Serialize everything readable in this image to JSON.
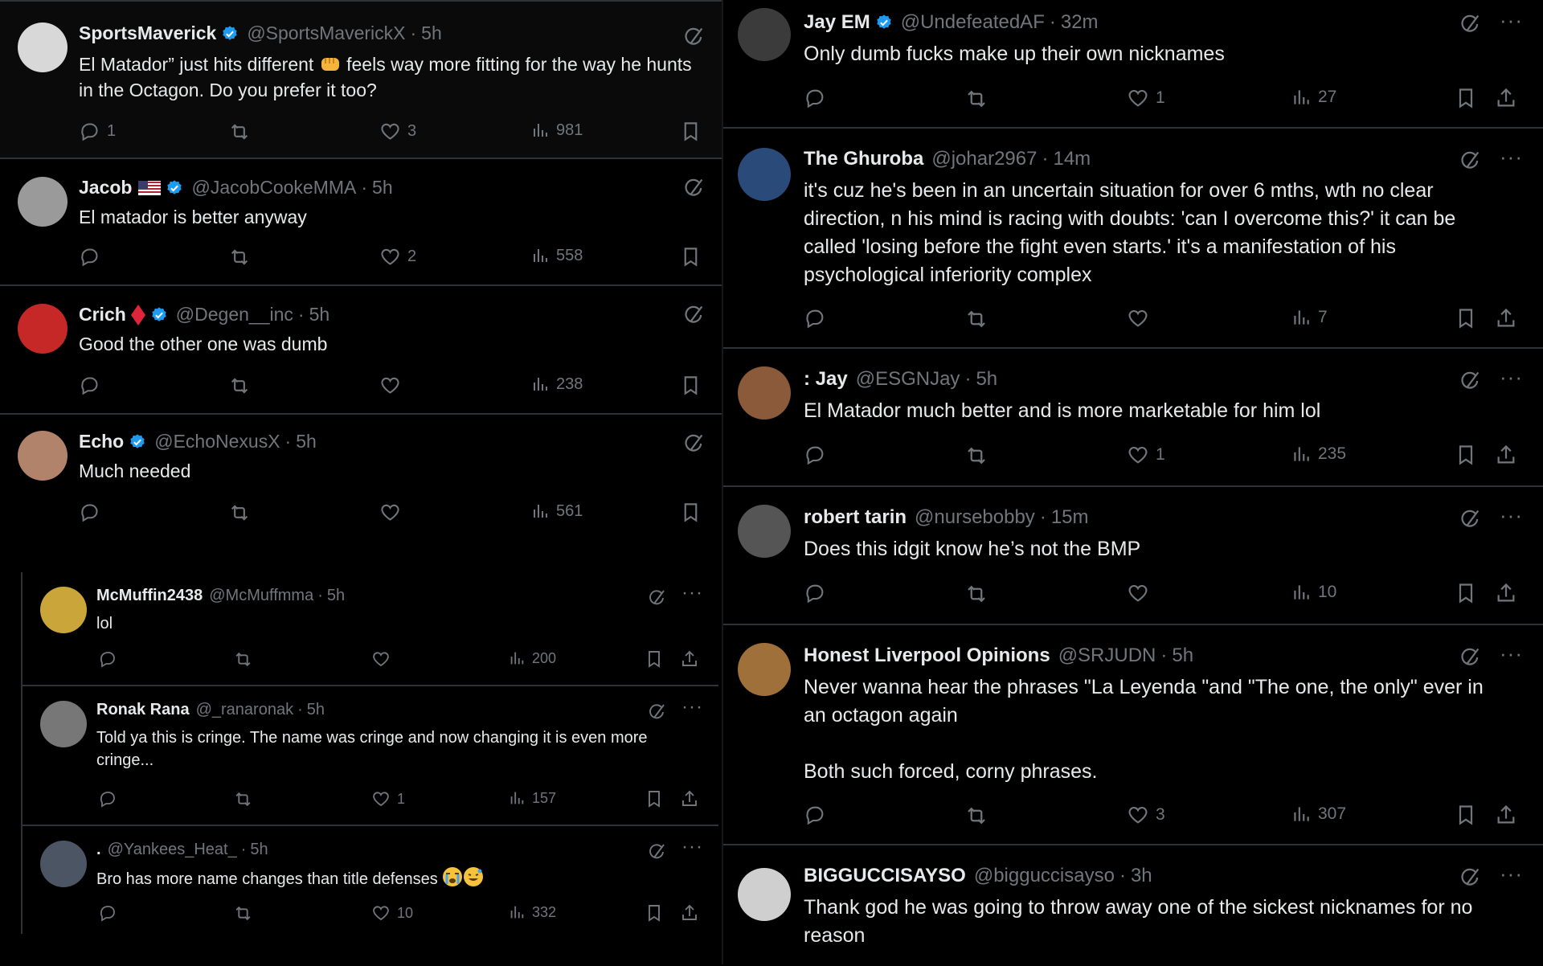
{
  "left": {
    "tweets": [
      {
        "name": "SportsMaverick",
        "handle": "@SportsMaverickX",
        "time": "5h",
        "text": "El Matador” just hits different",
        "text2": "feels way more fitting for the way he hunts in the Octagon. Do you prefer it too?",
        "replies": "1",
        "likes": "3",
        "views": "981",
        "avatar_color": "#d8d8d8"
      },
      {
        "name": "Jacob",
        "handle": "@JacobCookeMMA",
        "time": "5h",
        "text": "El matador is better anyway",
        "replies": "",
        "likes": "2",
        "views": "558",
        "avatar_color": "#9a9a9a"
      },
      {
        "name": "Crich",
        "handle": "@Degen__inc",
        "time": "5h",
        "text": "Good the other one was dumb",
        "replies": "",
        "likes": "",
        "views": "238",
        "avatar_color": "#c62828"
      },
      {
        "name": "Echo",
        "handle": "@EchoNexusX",
        "time": "5h",
        "text": "Much needed",
        "replies": "",
        "likes": "",
        "views": "561",
        "avatar_color": "#b0836a"
      }
    ],
    "thread": [
      {
        "name": "McMuffin2438",
        "handle": "@McMuffmma",
        "time": "5h",
        "text": "lol",
        "likes": "",
        "views": "200",
        "avatar_color": "#caa53a"
      },
      {
        "name": "Ronak Rana",
        "handle": "@_ranaronak",
        "time": "5h",
        "text": "Told ya this is cringe. The name was cringe and now changing it is even more cringe...",
        "likes": "1",
        "views": "157",
        "avatar_color": "#777"
      },
      {
        "name": ".",
        "handle": "@Yankees_Heat_",
        "time": "5h",
        "text": "Bro has more name changes than title defenses",
        "likes": "10",
        "views": "332",
        "avatar_color": "#4b5563"
      }
    ]
  },
  "right": {
    "tweets": [
      {
        "name": "Jay EM",
        "handle": "@UndefeatedAF",
        "time": "32m",
        "text": "Only dumb fucks make up their own nicknames",
        "likes": "1",
        "views": "27",
        "avatar_color": "#3b3b3b"
      },
      {
        "name": "The Ghuroba",
        "handle": "@johar2967",
        "time": "14m",
        "text": "it's cuz he's been in an uncertain situation for over 6 mths, wth no clear direction, n his mind is racing with doubts: 'can I overcome this?' it can be called 'losing before the fight even starts.' it's a manifestation of his psychological inferiority complex",
        "likes": "",
        "views": "7",
        "avatar_color": "#2a4a7a"
      },
      {
        "name": ": Jay",
        "handle": "@ESGNJay",
        "time": "5h",
        "text": "El Matador much better and is more marketable for him lol",
        "likes": "1",
        "views": "235",
        "avatar_color": "#8a5a3a"
      },
      {
        "name": "robert tarin",
        "handle": "@nursebobby",
        "time": "15m",
        "text": "Does this idgit know he’s not the BMP",
        "likes": "",
        "views": "10",
        "avatar_color": "#555"
      },
      {
        "name": "Honest Liverpool Opinions",
        "handle": "@SRJUDN",
        "time": "5h",
        "text": "Never wanna hear the phrases \"La Leyenda \"and \"The one, the only\" ever in an octagon again\n\nBoth such forced, corny phrases.",
        "likes": "3",
        "views": "307",
        "avatar_color": "#a0703a"
      },
      {
        "name": "BIGGUCCISAYSO",
        "handle": "@bigguccisayso",
        "time": "3h",
        "text": "Thank god he was going to throw away one of the sickest nicknames for no reason",
        "likes": "",
        "views": "",
        "avatar_color": "#cfcfcf"
      }
    ]
  },
  "colors": {
    "verified": "#1d9bf0",
    "muted": "#71767b",
    "text": "#e7e9ea",
    "divider": "#2f3336"
  },
  "icons": [
    "reply-icon",
    "retweet-icon",
    "like-icon",
    "views-icon",
    "bookmark-icon",
    "share-icon",
    "grok-icon",
    "more-icon",
    "verified-icon"
  ]
}
